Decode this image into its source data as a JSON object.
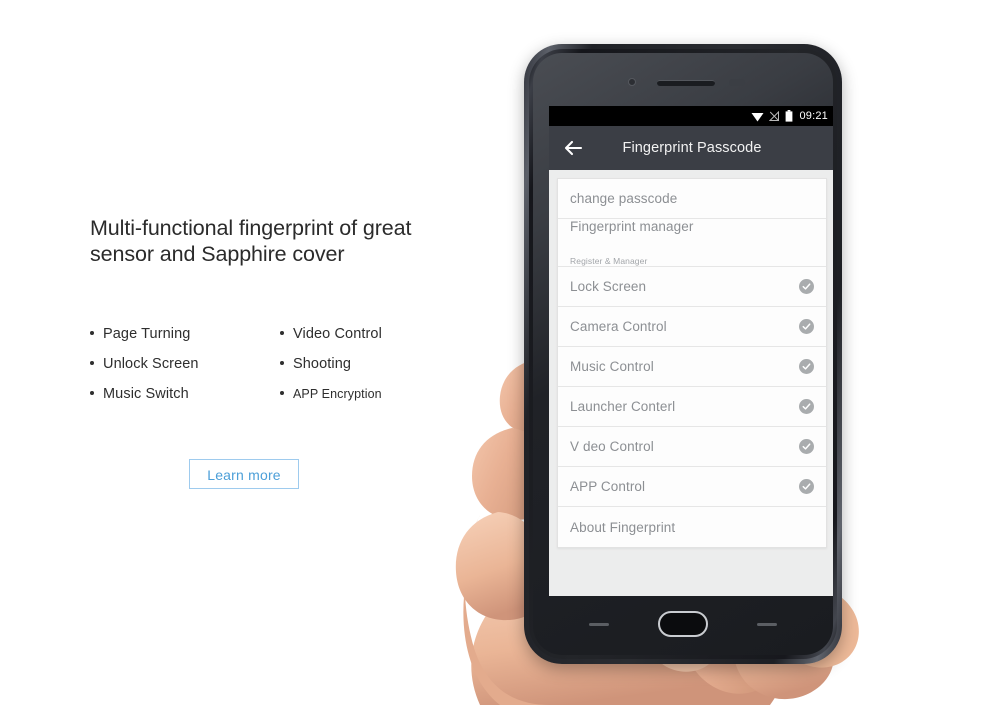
{
  "marketing": {
    "headline": "Multi-functional fingerprint of great\nsensor and Sapphire cover",
    "features_left": [
      {
        "label": "Page Turning"
      },
      {
        "label": "Unlock Screen"
      },
      {
        "label": "Music Switch"
      }
    ],
    "features_right": [
      {
        "label": "Video Control"
      },
      {
        "label": "Shooting"
      },
      {
        "label": "APP  Encryption"
      }
    ],
    "cta_label": "Learn more",
    "cta_color": "#4c9fd8",
    "cta_border_color": "#9ecbee"
  },
  "phone": {
    "statusbar": {
      "clock": "09:21",
      "icons": [
        "wifi-icon",
        "signal-off-icon",
        "battery-icon"
      ]
    },
    "appbar": {
      "back_icon": "back-arrow-icon",
      "title": "Fingerprint Passcode",
      "background": "#3b3e45"
    },
    "settings_rows": [
      {
        "title": "change passcode",
        "subtitle": "",
        "checked": false
      },
      {
        "title": "Fingerprint manager",
        "subtitle": "Register & Manager",
        "checked": false
      },
      {
        "title": "Lock Screen",
        "subtitle": "",
        "checked": true
      },
      {
        "title": "Camera Control",
        "subtitle": "",
        "checked": true
      },
      {
        "title": "Music Control",
        "subtitle": "",
        "checked": true
      },
      {
        "title": "Launcher Conterl",
        "subtitle": "",
        "checked": true
      },
      {
        "title": "V deo Control",
        "subtitle": "",
        "checked": true
      },
      {
        "title": "APP Control",
        "subtitle": "",
        "checked": true
      },
      {
        "title": "About Fingerprint",
        "subtitle": "",
        "checked": false
      }
    ],
    "hardware": {
      "home_button": "home-fingerprint-button",
      "cap_key_left": "recents-capacitive-key",
      "cap_key_right": "back-capacitive-key"
    }
  }
}
